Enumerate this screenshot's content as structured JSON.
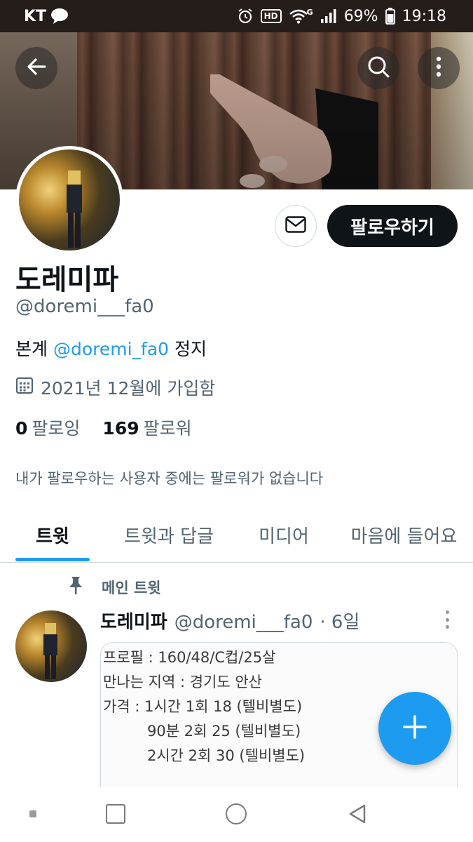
{
  "status_bar": {
    "carrier": "KT",
    "battery": "69%",
    "time": "19:18",
    "hd_label": "HD",
    "signal_label": "G",
    "icons": [
      "talk-icon",
      "alarm-icon",
      "hd-icon",
      "wifi-icon",
      "signal-icon",
      "battery-icon"
    ]
  },
  "header": {
    "icons": [
      "back-arrow-icon",
      "search-icon",
      "more-vertical-icon"
    ]
  },
  "profile": {
    "display_name": "도레미파",
    "handle": "@doremi___fa0",
    "bio_prefix": "본계 ",
    "bio_mention": "@doremi_fa0",
    "bio_suffix": " 정지",
    "joined": "2021년 12월에 가입함",
    "following_count": "0",
    "following_label": "팔로잉",
    "followers_count": "169",
    "followers_label": "팔로워",
    "followers_note": "내가 팔로우하는 사용자 중에는 팔로워가 없습니다",
    "follow_button": "팔로우하기",
    "icons": [
      "mail-icon",
      "calendar-icon"
    ]
  },
  "tabs": [
    {
      "label": "트윗",
      "active": true
    },
    {
      "label": "트윗과 답글",
      "active": false
    },
    {
      "label": "미디어",
      "active": false
    },
    {
      "label": "마음에 들어요",
      "active": false
    }
  ],
  "pinned_tweet": {
    "pinned_label": "메인 트윗",
    "author_name": "도레미파",
    "author_handle": "@doremi___fa0",
    "time": "· 6일",
    "media_lines": [
      {
        "text": "프로필 : 160/48/C컵/25살",
        "indent": false
      },
      {
        "text": "만나는 지역 : 경기도 안산",
        "indent": false
      },
      {
        "text": "가격 : 1시간 1회 18 (텔비별도)",
        "indent": false
      },
      {
        "text": "90분 2회 25 (텔비별도)",
        "indent": true
      },
      {
        "text": "2시간 2회 30 (텔비별도)",
        "indent": true
      }
    ],
    "icons": [
      "pin-icon",
      "more-vertical-icon"
    ]
  },
  "fab": {
    "icon": "plus-icon"
  },
  "nav_bar": {
    "icons": [
      "recent-dot-icon",
      "recents-icon",
      "home-icon",
      "back-icon"
    ]
  },
  "colors": {
    "accent": "#1d9bf0",
    "text": "#0f1419",
    "secondary": "#536471",
    "status_bar": "#251d1a"
  }
}
